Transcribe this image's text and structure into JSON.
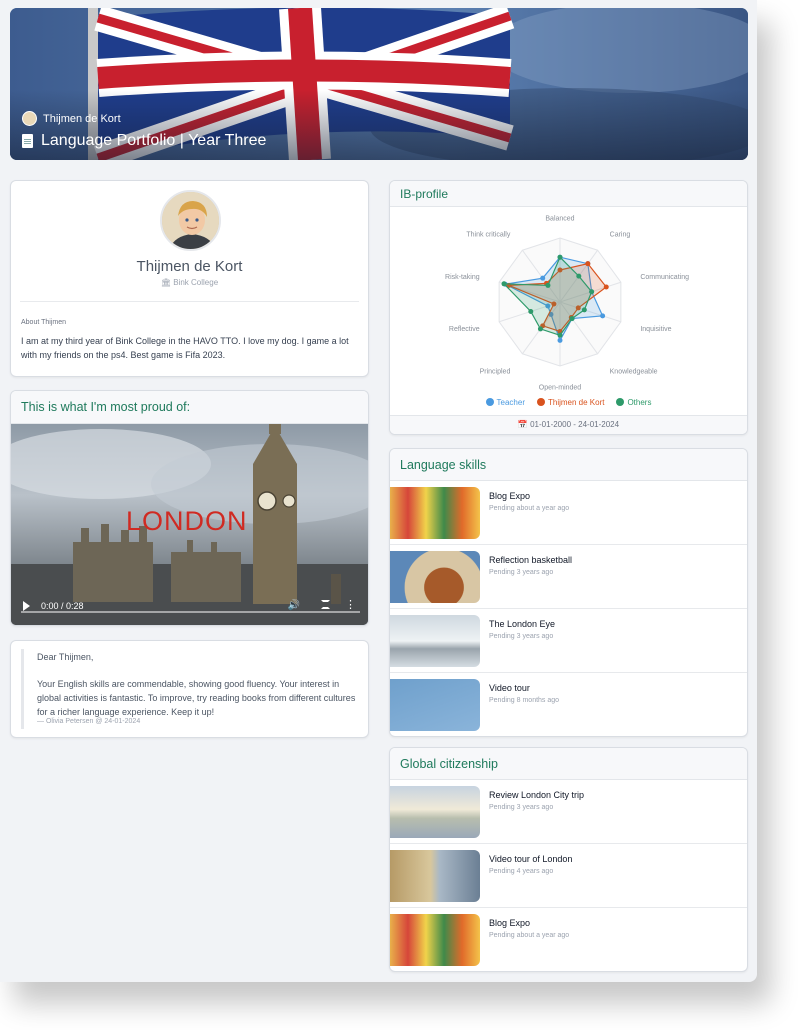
{
  "banner": {
    "owner": "Thijmen de Kort",
    "title": "Language Portfolio | Year Three"
  },
  "profile": {
    "name": "Thijmen de Kort",
    "school": "Bink College",
    "about_label": "About Thijmen",
    "about_text": "I am at my third year of Bink College in the HAVO TTO. I love my dog. I game a lot with my friends on the ps4. Best game is Fifa 2023."
  },
  "proud": {
    "title": "This is what I'm most proud of:",
    "video_overlay": "LONDON",
    "video_time": "0:00 / 0:28"
  },
  "feedback": {
    "greeting": "Dear Thijmen,",
    "body": "Your English skills are commendable, showing good fluency. Your interest in global activities is fantastic. To improve, try reading books from different cultures for a richer language experience. Keep it up!",
    "signature": "— Olivia Petersen @ 24-01-2024"
  },
  "ib_profile": {
    "title": "IB-profile",
    "date_range": "01-01-2000 - 24-01-2024",
    "legend": [
      "Teacher",
      "Thijmen de Kort",
      "Others"
    ],
    "colors": {
      "teacher": "#4a9ae0",
      "student": "#d9531e",
      "others": "#2e9a6a"
    }
  },
  "chart_data": {
    "type": "radar",
    "categories": [
      "Balanced",
      "Caring",
      "Communicating",
      "Inquisitive",
      "Knowledgeable",
      "Open-minded",
      "Principled",
      "Reflective",
      "Risk-taking",
      "Think critically"
    ],
    "ylim": [
      0,
      5
    ],
    "series": [
      {
        "name": "Teacher",
        "values": [
          3.5,
          3.7,
          2.6,
          3.5,
          1.6,
          3.0,
          1.2,
          1.0,
          4.5,
          2.3
        ]
      },
      {
        "name": "Thijmen de Kort",
        "values": [
          2.5,
          3.7,
          3.8,
          1.5,
          1.5,
          2.3,
          2.3,
          0.5,
          4.2,
          1.8
        ]
      },
      {
        "name": "Others",
        "values": [
          3.5,
          2.5,
          2.6,
          2.0,
          1.6,
          2.6,
          2.6,
          2.4,
          4.6,
          1.6
        ]
      }
    ]
  },
  "language_skills": {
    "title": "Language skills",
    "items": [
      {
        "title": "Blog Expo",
        "status": "Pending about a year ago"
      },
      {
        "title": "Reflection basketball",
        "status": "Pending 3 years ago"
      },
      {
        "title": "The London Eye",
        "status": "Pending 3 years ago"
      },
      {
        "title": "Video tour",
        "status": "Pending 8 months ago"
      }
    ]
  },
  "global_citizenship": {
    "title": "Global citizenship",
    "items": [
      {
        "title": "Review London City trip",
        "status": "Pending 3 years ago"
      },
      {
        "title": "Video tour of London",
        "status": "Pending 4 years ago"
      },
      {
        "title": "Blog Expo",
        "status": "Pending about a year ago"
      }
    ]
  }
}
